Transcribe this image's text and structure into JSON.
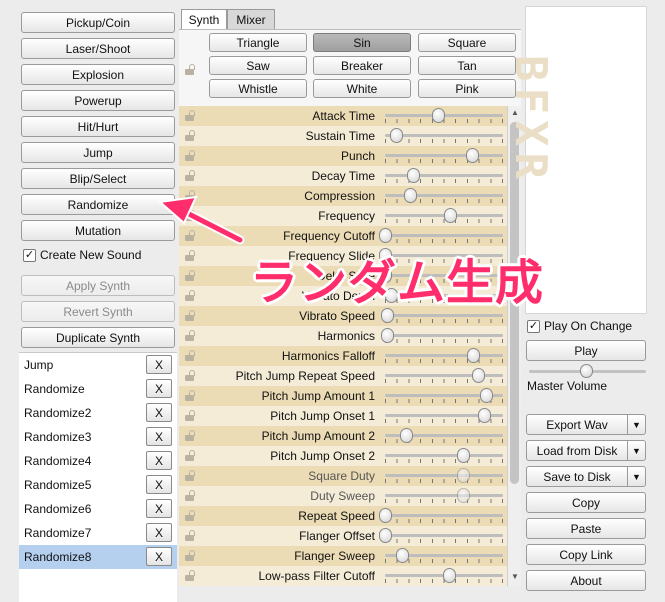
{
  "left_buttons": {
    "pickup": "Pickup/Coin",
    "laser": "Laser/Shoot",
    "explosion": "Explosion",
    "powerup": "Powerup",
    "hit": "Hit/Hurt",
    "jump": "Jump",
    "blip": "Blip/Select",
    "randomize": "Randomize",
    "mutation": "Mutation"
  },
  "create_new_sound": {
    "label": "Create New Sound",
    "checked": true
  },
  "apply_synth": "Apply Synth",
  "revert_synth": "Revert Synth",
  "duplicate_synth": "Duplicate Synth",
  "history": {
    "delete_label": "X",
    "items": [
      "Jump",
      "Randomize",
      "Randomize2",
      "Randomize3",
      "Randomize4",
      "Randomize5",
      "Randomize6",
      "Randomize7",
      "Randomize8"
    ],
    "selected": "Randomize8"
  },
  "tabs": {
    "synth": "Synth",
    "mixer": "Mixer",
    "active": "Synth"
  },
  "waveforms": {
    "items": [
      "Triangle",
      "Sin",
      "Square",
      "Saw",
      "Breaker",
      "Tan",
      "Whistle",
      "White",
      "Pink"
    ],
    "selected": "Sin"
  },
  "params": [
    {
      "label": "Attack Time",
      "value": 0.47
    },
    {
      "label": "Sustain Time",
      "value": 0.1
    },
    {
      "label": "Punch",
      "value": 0.78
    },
    {
      "label": "Decay Time",
      "value": 0.25
    },
    {
      "label": "Compression",
      "value": 0.22
    },
    {
      "label": "Frequency",
      "value": 0.58
    },
    {
      "label": "Frequency Cutoff",
      "value": 0.0
    },
    {
      "label": "Frequency Slide",
      "value": 0.0
    },
    {
      "label": "Delta Slide",
      "value": 0.0
    },
    {
      "label": "Vibrato Depth",
      "value": 0.05
    },
    {
      "label": "Vibrato Speed",
      "value": 0.02
    },
    {
      "label": "Harmonics",
      "value": 0.02
    },
    {
      "label": "Harmonics Falloff",
      "value": 0.79
    },
    {
      "label": "Pitch Jump Repeat Speed",
      "value": 0.83
    },
    {
      "label": "Pitch Jump Amount 1",
      "value": 0.9
    },
    {
      "label": "Pitch Jump Onset 1",
      "value": 0.88
    },
    {
      "label": "Pitch Jump Amount 2",
      "value": 0.19
    },
    {
      "label": "Pitch Jump Onset 2",
      "value": 0.7
    },
    {
      "label": "Square Duty",
      "value": 0.7,
      "dim": true
    },
    {
      "label": "Duty Sweep",
      "value": 0.7,
      "dim": true
    },
    {
      "label": "Repeat Speed",
      "value": 0.0
    },
    {
      "label": "Flanger Offset",
      "value": 0.0
    },
    {
      "label": "Flanger Sweep",
      "value": 0.15
    },
    {
      "label": "Low-pass Filter Cutoff",
      "value": 0.57
    }
  ],
  "logo_text": "BFXR",
  "play_on_change": {
    "label": "Play On Change",
    "checked": true
  },
  "play": "Play",
  "master_volume": {
    "label": "Master Volume",
    "value": 0.45
  },
  "export_wav": "Export Wav",
  "load_from_disk": "Load from Disk",
  "save_to_disk": "Save to Disk",
  "copy": "Copy",
  "paste": "Paste",
  "copy_link": "Copy Link",
  "about": "About",
  "dropdown_arrow": "▼",
  "annotation": {
    "text": "ランダム生成",
    "color": "#ff2d6b"
  }
}
